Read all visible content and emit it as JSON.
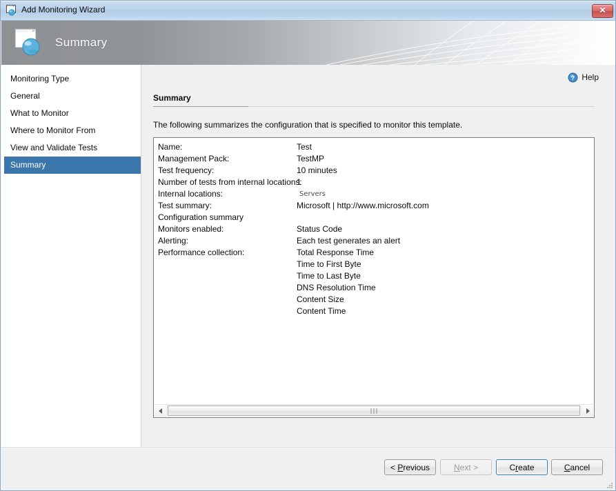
{
  "window": {
    "title": "Add Monitoring Wizard",
    "title_icon": "wizard-window-icon",
    "close_label": "✕"
  },
  "banner": {
    "title": "Summary",
    "icon": "wizard-page-globe-icon"
  },
  "sidebar": {
    "items": [
      {
        "label": "Monitoring Type",
        "selected": false
      },
      {
        "label": "General",
        "selected": false
      },
      {
        "label": "What to Monitor",
        "selected": false
      },
      {
        "label": "Where to Monitor From",
        "selected": false
      },
      {
        "label": "View and Validate Tests",
        "selected": false
      },
      {
        "label": "Summary",
        "selected": true
      }
    ]
  },
  "content": {
    "help_label": "Help",
    "help_icon": "help-circle-icon",
    "section_title": "Summary",
    "intro": "The following summarizes the configuration that is specified to monitor this template.",
    "rows": [
      {
        "label": "Name:",
        "value": "Test",
        "muted": false
      },
      {
        "label": "Management Pack:",
        "value": "TestMP",
        "muted": false
      },
      {
        "label": "Test frequency:",
        "value": "10 minutes",
        "muted": false
      },
      {
        "label": "Number of tests from internal locations:",
        "value": "1",
        "muted": false
      },
      {
        "label": "Internal locations:",
        "value": "Servers",
        "muted": true
      },
      {
        "label": "Test summary:",
        "value": "Microsoft | http://www.microsoft.com",
        "muted": false
      },
      {
        "label": "Configuration summary",
        "value": "",
        "muted": false
      },
      {
        "label": "Monitors enabled:",
        "value": "Status Code",
        "muted": false
      },
      {
        "label": "Alerting:",
        "value": "Each test generates an alert",
        "muted": false
      },
      {
        "label": "Performance collection:",
        "value": "Total Response Time",
        "muted": false
      },
      {
        "label": "",
        "value": "Time to First Byte",
        "muted": false
      },
      {
        "label": "",
        "value": "Time to Last Byte",
        "muted": false
      },
      {
        "label": "",
        "value": "DNS Resolution Time",
        "muted": false
      },
      {
        "label": "",
        "value": "Content Size",
        "muted": false
      },
      {
        "label": "",
        "value": "Content Time",
        "muted": false
      }
    ],
    "scrollbar": {
      "left_arrow": "scroll-left-arrow",
      "right_arrow": "scroll-right-arrow"
    }
  },
  "footer": {
    "buttons": [
      {
        "id": "previous",
        "prefix": "< ",
        "accel": "P",
        "rest": "revious",
        "state": "enabled"
      },
      {
        "id": "next",
        "prefix": "",
        "accel": "N",
        "rest": "ext >",
        "state": "disabled"
      },
      {
        "id": "create",
        "prefix": "C",
        "accel": "r",
        "rest": "eate",
        "state": "default"
      },
      {
        "id": "cancel",
        "prefix": "",
        "accel": "C",
        "rest": "ancel",
        "state": "enabled"
      }
    ]
  },
  "colors": {
    "selection": "#3a76ab",
    "titlebar": "#b2cce6",
    "close_button": "#c85150",
    "default_button_border": "#2c82c4",
    "page_bg": "#f0f0f0"
  }
}
